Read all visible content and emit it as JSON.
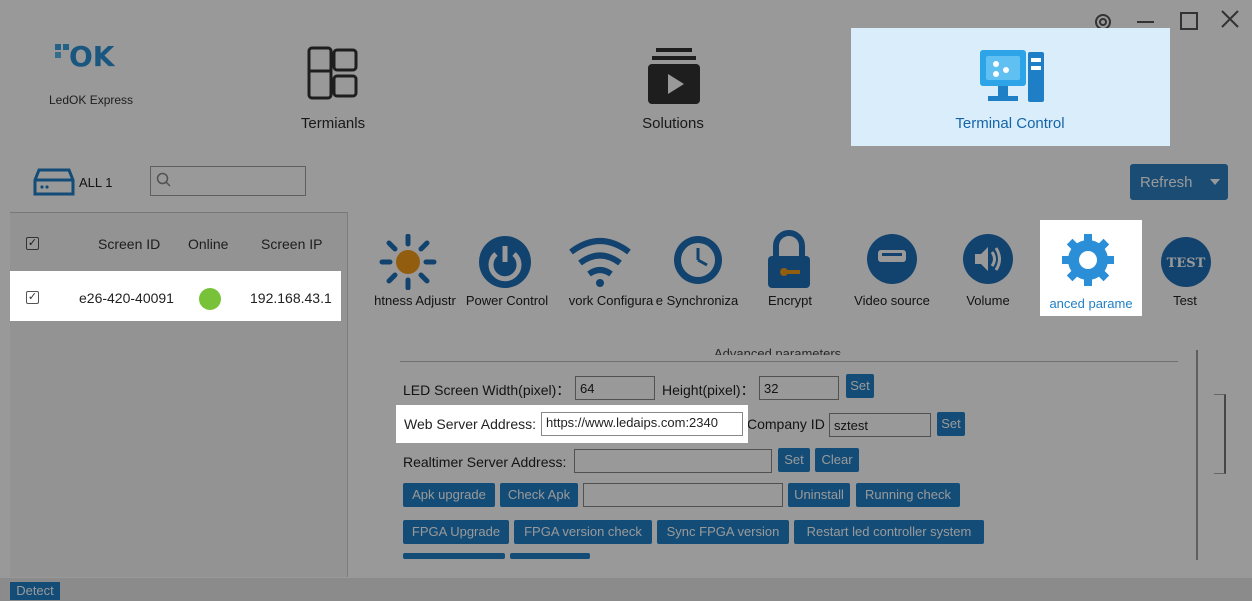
{
  "window": {
    "app_name": "LedOK Express",
    "logo_text": "OK"
  },
  "nav": {
    "terminals_label": "Termianls",
    "solutions_label": "Solutions",
    "terminal_control_label": "Terminal Control"
  },
  "toolbar": {
    "all_label": "ALL 1",
    "search_placeholder": "",
    "refresh_label": "Refresh"
  },
  "table": {
    "columns": [
      "Screen ID",
      "Online",
      "Screen IP"
    ],
    "rows": [
      {
        "screen_id": "e26-420-40091",
        "online": true,
        "screen_ip": "192.168.43.1",
        "checked": true
      }
    ]
  },
  "functions": [
    {
      "label": "htness Adjustr",
      "icon": "sun-icon"
    },
    {
      "label": "Power Control",
      "icon": "power-icon"
    },
    {
      "label": "vork Configura",
      "icon": "wifi-icon"
    },
    {
      "label": "e Synchroniza",
      "icon": "clock-icon"
    },
    {
      "label": "Encrypt",
      "icon": "lock-icon"
    },
    {
      "label": "Video source",
      "icon": "video-icon"
    },
    {
      "label": "Volume",
      "icon": "speaker-icon"
    },
    {
      "label": "anced parame",
      "icon": "gear-icon"
    },
    {
      "label": "Test",
      "icon": "test-icon"
    }
  ],
  "test_icon_text": "TEST",
  "params": {
    "section_title": "Advanced parameters",
    "width_label": "LED Screen Width(pixel)：",
    "width_value": "64",
    "height_label": "Height(pixel)：",
    "height_value": "32",
    "set_label": "Set",
    "web_server_label": "Web Server Address:",
    "web_server_value": "https://www.ledaips.com:2340",
    "company_id_label": "Company ID",
    "company_id_value": "sztest",
    "realtimer_label": "Realtimer Server Address:",
    "realtimer_value": "",
    "clear_label": "Clear",
    "apk_upgrade_label": "Apk upgrade",
    "check_apk_label": "Check Apk",
    "apk_select_value": "",
    "uninstall_label": "Uninstall",
    "running_check_label": "Running check",
    "fpga_upgrade_label": "FPGA Upgrade",
    "fpga_version_check_label": "FPGA version check",
    "sync_fpga_label": "Sync FPGA version",
    "restart_label": "Restart led controller system"
  },
  "status": {
    "detect_label": "Detect"
  },
  "colors": {
    "accent": "#1f7fc6",
    "online": "#78c23a",
    "highlight_tile": "#d9edfb"
  }
}
